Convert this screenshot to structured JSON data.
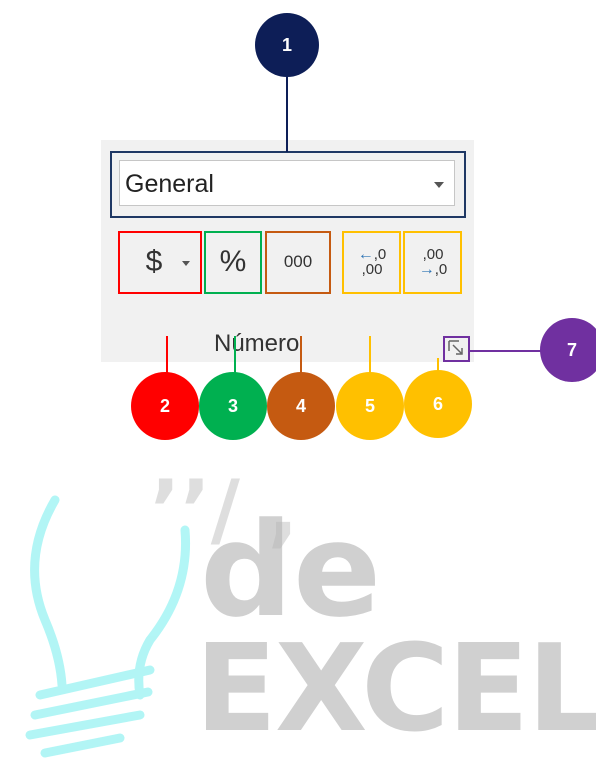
{
  "watermark": {
    "word1": "de",
    "word2": "EXCEL"
  },
  "format_dropdown": {
    "value": "General"
  },
  "buttons": {
    "currency_symbol": "$",
    "percent_symbol": "%",
    "thousands_label": "000",
    "increase_decimal_top": ",0",
    "increase_decimal_bottom": ",00",
    "decrease_decimal_top": ",00",
    "decrease_decimal_bottom": ",0"
  },
  "group_label": "Número",
  "callouts": [
    {
      "label": "1",
      "color": "#0d1e57"
    },
    {
      "label": "2",
      "color": "#ff0000"
    },
    {
      "label": "3",
      "color": "#00b050"
    },
    {
      "label": "4",
      "color": "#c55a11"
    },
    {
      "label": "5",
      "color": "#ffc000"
    },
    {
      "label": "6",
      "color": "#ffc000"
    },
    {
      "label": "7",
      "color": "#7030a0"
    }
  ]
}
